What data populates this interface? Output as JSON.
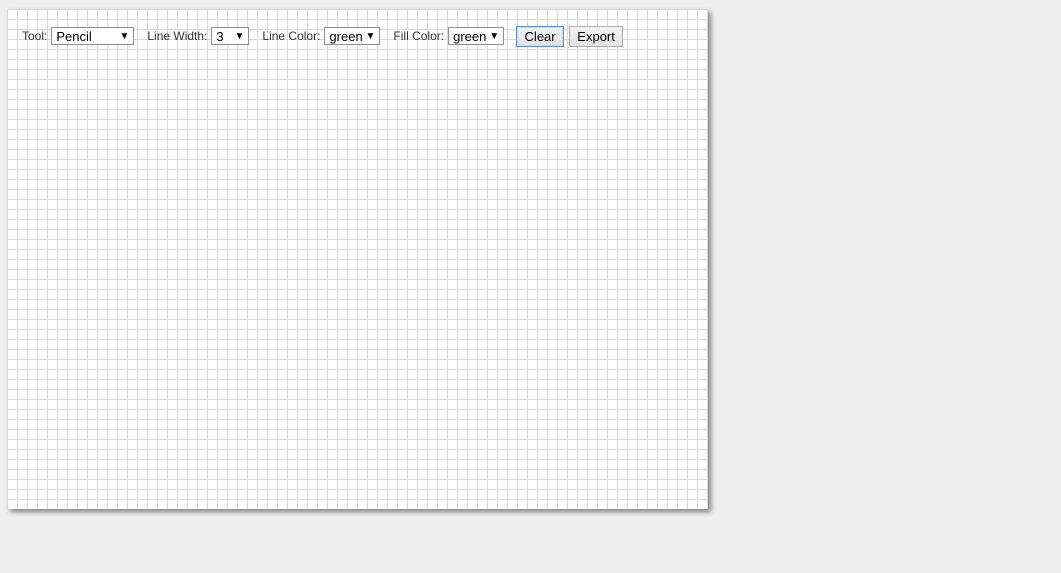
{
  "toolbar": {
    "tool": {
      "label": "Tool:",
      "value": "Pencil"
    },
    "line_width": {
      "label": "Line Width:",
      "value": "3"
    },
    "line_color": {
      "label": "Line Color:",
      "value": "green"
    },
    "fill_color": {
      "label": "Fill Color:",
      "value": "green"
    },
    "clear_label": "Clear",
    "export_label": "Export"
  },
  "icons": {
    "dropdown_arrow": "▼"
  },
  "colors": {
    "page_background": "#efefef",
    "canvas_background": "#ffffff",
    "grid_line": "#d9d9d9"
  }
}
